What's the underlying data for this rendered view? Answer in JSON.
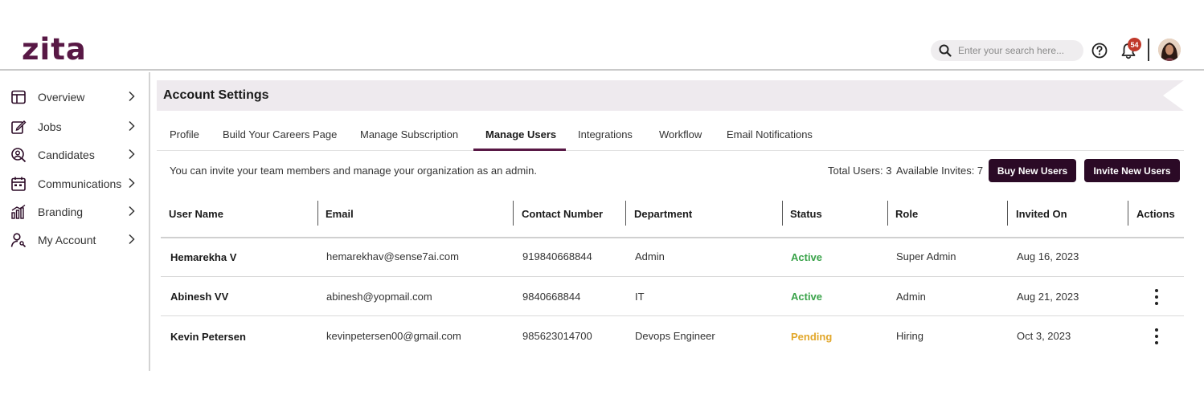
{
  "header": {
    "logo": "zita",
    "search_placeholder": "Enter your search here...",
    "notification_count": "54"
  },
  "sidebar": {
    "items": [
      {
        "label": "Overview",
        "icon": "layout-icon"
      },
      {
        "label": "Jobs",
        "icon": "edit-icon"
      },
      {
        "label": "Candidates",
        "icon": "candidate-search-icon"
      },
      {
        "label": "Communications",
        "icon": "calendar-chat-icon"
      },
      {
        "label": "Branding",
        "icon": "chart-icon"
      },
      {
        "label": "My Account",
        "icon": "user-key-icon"
      }
    ]
  },
  "page": {
    "title": "Account Settings",
    "tabs": [
      "Profile",
      "Build Your Careers Page",
      "Manage Subscription",
      "Manage Users",
      "Integrations",
      "Workflow",
      "Email Notifications"
    ],
    "active_tab": "Manage Users",
    "intro": "You can invite your team members and manage your organization as an admin.",
    "total_users": "Total Users: 3",
    "available_invites": "Available Invites: 7",
    "buy_button": "Buy New Users",
    "invite_button": "Invite New Users"
  },
  "table": {
    "columns": [
      "User Name",
      "Email",
      "Contact Number",
      "Department",
      "Status",
      "Role",
      "Invited On",
      "Actions"
    ],
    "rows": [
      {
        "name": "Hemarekha V",
        "email": "hemarekhav@sense7ai.com",
        "contact": "919840668844",
        "department": "Admin",
        "status": "Active",
        "role": "Super Admin",
        "invited": "Aug 16, 2023",
        "has_actions": false
      },
      {
        "name": "Abinesh VV",
        "email": "abinesh@yopmail.com",
        "contact": "9840668844",
        "department": "IT",
        "status": "Active",
        "role": "Admin",
        "invited": "Aug 21, 2023",
        "has_actions": true
      },
      {
        "name": "Kevin Petersen",
        "email": "kevinpetersen00@gmail.com",
        "contact": "985623014700",
        "department": "Devops Engineer",
        "status": "Pending",
        "role": "Hiring",
        "invited": "Oct 3, 2023",
        "has_actions": true
      }
    ]
  },
  "colors": {
    "brand": "#581845",
    "button_bg": "#2b0a26",
    "active": "#3aa34a",
    "pending": "#e2a72a"
  }
}
